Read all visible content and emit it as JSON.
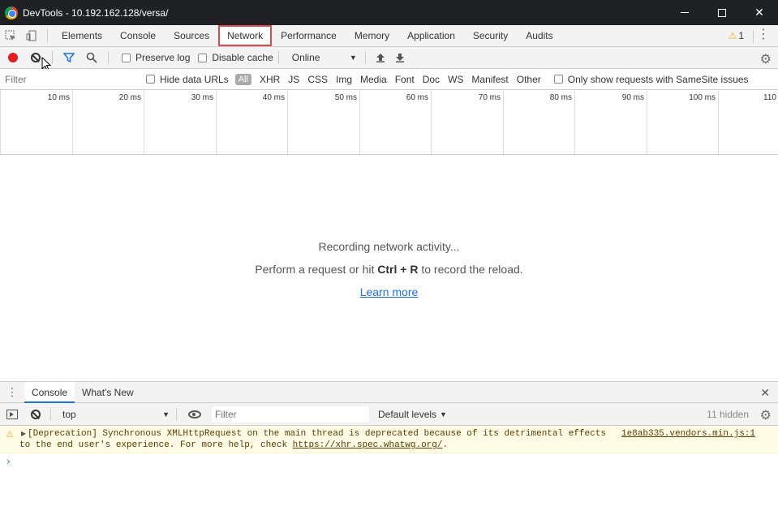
{
  "window": {
    "title": "DevTools - 10.192.162.128/versa/",
    "minimize_label": "",
    "close_label": "✕"
  },
  "main_tabs": [
    {
      "label": "Elements"
    },
    {
      "label": "Console"
    },
    {
      "label": "Sources"
    },
    {
      "label": "Network",
      "selected": true
    },
    {
      "label": "Performance"
    },
    {
      "label": "Memory"
    },
    {
      "label": "Application"
    },
    {
      "label": "Security"
    },
    {
      "label": "Audits"
    }
  ],
  "warnings": {
    "count": "1"
  },
  "network_toolbar": {
    "preserve_log_label": "Preserve log",
    "disable_cache_label": "Disable cache",
    "throttling_value": "Online"
  },
  "filter_bar": {
    "placeholder": "Filter",
    "hide_data_urls_label": "Hide data URLs",
    "types": [
      "All",
      "XHR",
      "JS",
      "CSS",
      "Img",
      "Media",
      "Font",
      "Doc",
      "WS",
      "Manifest",
      "Other"
    ],
    "samesite_label": "Only show requests with SameSite issues"
  },
  "timeline": {
    "ticks": [
      "10 ms",
      "20 ms",
      "30 ms",
      "40 ms",
      "50 ms",
      "60 ms",
      "70 ms",
      "80 ms",
      "90 ms",
      "100 ms",
      "110"
    ]
  },
  "empty_state": {
    "recording": "Recording network activity...",
    "perform_prefix": "Perform a request or hit ",
    "shortcut": "Ctrl + R",
    "perform_suffix": " to record the reload.",
    "learn_more": "Learn more"
  },
  "drawer": {
    "tabs": [
      {
        "label": "Console",
        "selected": true
      },
      {
        "label": "What's New"
      }
    ],
    "context_value": "top",
    "filter_placeholder": "Filter",
    "levels_label": "Default levels",
    "hidden_count": "11 hidden"
  },
  "console_message": {
    "line1": "[Deprecation] Synchronous XMLHttpRequest on the main thread is deprecated because of its detrimental effects",
    "line2_prefix": "to the end user's experience. For more help, check ",
    "link": "https://xhr.spec.whatwg.org/",
    "line2_suffix": ".",
    "source": "1e8ab335.vendors.min.js:1"
  },
  "colors": {
    "accent": "#1a73e8",
    "record": "#e41e1e",
    "highlight": "#e0494b",
    "warning_bg": "#fffbe5"
  }
}
